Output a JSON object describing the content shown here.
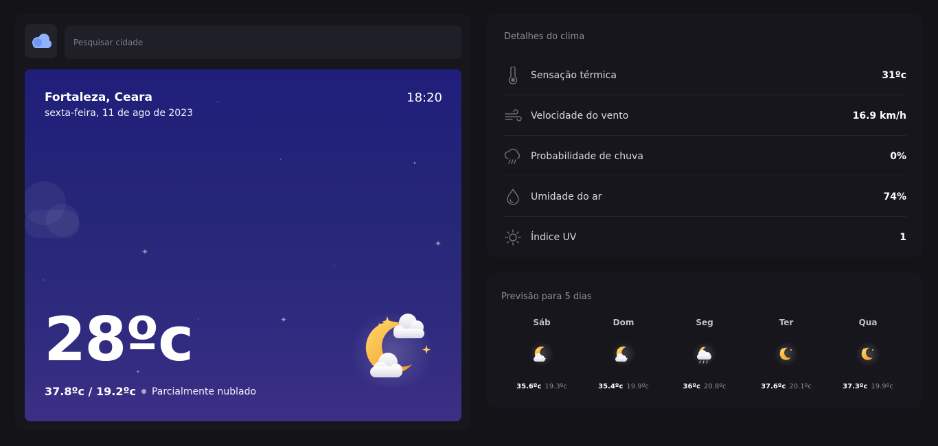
{
  "search": {
    "placeholder": "Pesquisar cidade"
  },
  "current": {
    "city": "Fortaleza, Ceara",
    "date": "sexta-feira, 11 de ago de 2023",
    "time": "18:20",
    "temperature": "28ºc",
    "min_max": "37.8ºc / 19.2ºc",
    "description": "Parcialmente nublado",
    "icon": "moon-cloud-icon"
  },
  "details": {
    "title": "Detalhes do clima",
    "rows": [
      {
        "label": "Sensação térmica",
        "value": "31ºc",
        "icon": "thermometer-icon"
      },
      {
        "label": "Velocidade do vento",
        "value": "16.9 km/h",
        "icon": "wind-icon"
      },
      {
        "label": "Probabilidade de chuva",
        "value": "0%",
        "icon": "rain-cloud-icon"
      },
      {
        "label": "Umidade do ar",
        "value": "74%",
        "icon": "droplet-icon"
      },
      {
        "label": "Índice UV",
        "value": "1",
        "icon": "sun-icon"
      }
    ]
  },
  "forecast": {
    "title": "Previsão para 5 dias",
    "days": [
      {
        "day": "Sáb",
        "max": "35.6ºc",
        "min": "19.3ºc",
        "icon": "moon-cloud-icon"
      },
      {
        "day": "Dom",
        "max": "35.4ºc",
        "min": "19.9ºc",
        "icon": "moon-cloud-icon"
      },
      {
        "day": "Seg",
        "max": "36ºc",
        "min": "20.8ºc",
        "icon": "rain-cloud-icon"
      },
      {
        "day": "Ter",
        "max": "37.6ºc",
        "min": "20.1ºc",
        "icon": "moon-icon"
      },
      {
        "day": "Qua",
        "max": "37.3ºc",
        "min": "19.9ºc",
        "icon": "moon-icon"
      }
    ]
  },
  "colors": {
    "background": "#131318",
    "panel": "#16161c",
    "hero_top": "#1f1e7a",
    "hero_bottom": "#3b2f86",
    "moon": "#f6b13c",
    "logo_cloud": "#8fb4ff"
  }
}
